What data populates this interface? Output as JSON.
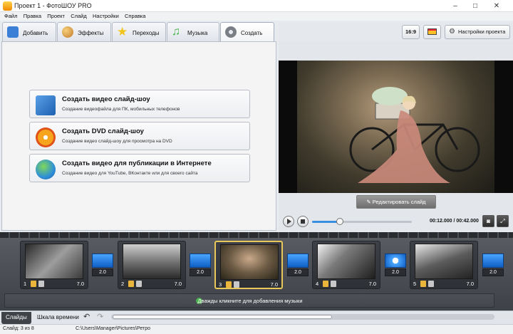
{
  "window": {
    "title": "Проект 1 - ФотоШОУ PRO",
    "min": "–",
    "max": "□",
    "close": "✕"
  },
  "menu": [
    "Файл",
    "Правка",
    "Проект",
    "Слайд",
    "Настройки",
    "Справка"
  ],
  "tabs": [
    {
      "label": "Добавить",
      "icon": "folder-icon",
      "color": "#3b7fd6"
    },
    {
      "label": "Эффекты",
      "icon": "palette-icon",
      "color": "#d9a441"
    },
    {
      "label": "Переходы",
      "icon": "star-icon",
      "color": "#f2c41c"
    },
    {
      "label": "Музыка",
      "icon": "music-note-icon",
      "color": "#46b34a"
    },
    {
      "label": "Создать",
      "icon": "film-reel-icon",
      "color": "#777b82"
    }
  ],
  "actions": [
    {
      "title": "Создать видео слайд-шоу",
      "subtitle": "Создание видеофайла для ПК, мобильных телефонов",
      "icon": "devices-icon"
    },
    {
      "title": "Создать DVD слайд-шоу",
      "subtitle": "Создание видео слайд-шоу для просмотра на DVD",
      "icon": "dvd-disc-icon"
    },
    {
      "title": "Создать видео для публикации в Интернете",
      "subtitle": "Создание видео для YouTube, ВКонтакте или для своего сайта",
      "icon": "globe-icon"
    }
  ],
  "header": {
    "aspect": "16:9",
    "settings": "Настройки проекта"
  },
  "preview": {
    "edit_slide": "Редактировать слайд",
    "timecode": "00:12.000 / 00:42.000",
    "progress": 0.28
  },
  "slides": [
    {
      "num": "1",
      "dur": "7.0"
    },
    {
      "num": "2",
      "dur": "7.0"
    },
    {
      "num": "3",
      "dur": "7.0"
    },
    {
      "num": "4",
      "dur": "7.0"
    },
    {
      "num": "5",
      "dur": "7.0"
    }
  ],
  "transitions": [
    "2.0",
    "2.0",
    "2.0",
    "2.0",
    "2.0"
  ],
  "music": {
    "hint": "Дважды кликните для добавления музыки"
  },
  "bottom_tabs": {
    "slides": "Слайды",
    "timeline": "Шкала времени"
  },
  "status": {
    "slide": "Слайд: 3 из 8",
    "path": "C:\\Users\\Manager\\Pictures\\Ретро"
  },
  "colors": {
    "accent": "#3b8fe0",
    "selected_slide": "#e9c85b",
    "transition": "#1f7ae0"
  }
}
